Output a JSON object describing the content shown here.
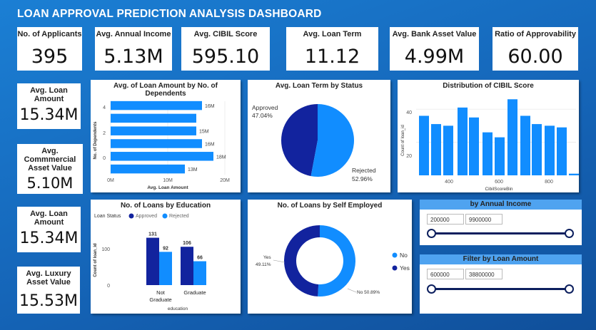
{
  "title": "LOAN APPROVAL PREDICTION ANALYSIS DASHBOARD",
  "kpis_top": [
    {
      "label": "No. of Applicants",
      "value": "395"
    },
    {
      "label": "Avg. Annual Income",
      "value": "5.13M"
    },
    {
      "label": "Avg. CIBIL Score",
      "value": "595.10"
    },
    {
      "label": "Avg. Loan Term",
      "value": "11.12"
    },
    {
      "label": "Avg. Bank Asset Value",
      "value": "4.99M"
    },
    {
      "label": "Ratio of Approvability",
      "value": "60.00"
    }
  ],
  "kpis_side": [
    {
      "label": "Avg. Loan Amount",
      "value": "15.34M"
    },
    {
      "label": "Avg. Commmercial Asset Value",
      "value": "5.10M"
    },
    {
      "label": "Avg. Loan Amount",
      "value": "15.34M"
    },
    {
      "label": "Avg. Luxury Asset Value",
      "value": "15.53M"
    }
  ],
  "charts": {
    "dependents": {
      "title": "Avg. of Loan Amount by No. of Dependents",
      "ylabel": "No. of Dependents",
      "xlabel": "Avg. Loan Amount",
      "xticks": [
        "0M",
        "10M",
        "20M"
      ]
    },
    "loan_term": {
      "title": "Avg. Loan Term by Status",
      "approved_label": "Approved",
      "approved_pct": "47.04%",
      "rejected_label": "Rejected",
      "rejected_pct": "52.96%"
    },
    "cibil": {
      "title": "Distribution of CIBIL Score",
      "ylabel": "Count of loan_id",
      "xlabel": "CibilScoreBin",
      "yticks": [
        "20",
        "40"
      ],
      "xticks": [
        "400",
        "600",
        "800"
      ]
    },
    "education": {
      "title": "No. of Loans by Education",
      "legend_title": "Loan Status",
      "legend_approved": "Approved",
      "legend_rejected": "Rejected",
      "ylabel": "Count of loan_id",
      "xlabel": "education",
      "yticks": [
        "0",
        "100"
      ],
      "cat1_line1": "Not",
      "cat1_line2": "Graduate",
      "cat2": "Graduate"
    },
    "self_employed": {
      "title": "No. of Loans by Self Employed",
      "yes_label": "Yes",
      "yes_pct": "49.11%",
      "no_label": "No 50.89%",
      "legend_no": "No",
      "legend_yes": "Yes"
    }
  },
  "sliders": {
    "income": {
      "title": "by Annual Income",
      "min": "200000",
      "max": "9900000"
    },
    "loan": {
      "title": "Filter by Loan Amount",
      "min": "600000",
      "max": "38800000"
    }
  },
  "colors": {
    "approved": "#12239e",
    "rejected": "#118dff",
    "bar": "#118dff"
  },
  "chart_data": [
    {
      "type": "bar",
      "title": "Avg. of Loan Amount by No. of Dependents",
      "orientation": "horizontal",
      "xlabel": "Avg. Loan Amount",
      "ylabel": "No. of Dependents",
      "categories": [
        "0",
        "1",
        "2",
        "3",
        "4",
        "5"
      ],
      "values": [
        13,
        18,
        16,
        15,
        15,
        16
      ],
      "data_labels": [
        "13M",
        "18M",
        "16M",
        "15M",
        "",
        "16M"
      ],
      "xlim": [
        0,
        20
      ],
      "tick_labels_y": [
        "0",
        "2",
        "4"
      ]
    },
    {
      "type": "pie",
      "title": "Avg. Loan Term by Status",
      "categories": [
        "Approved",
        "Rejected"
      ],
      "values": [
        47.04,
        52.96
      ]
    },
    {
      "type": "bar",
      "title": "Distribution of CIBIL Score",
      "xlabel": "CibilScoreBin",
      "ylabel": "Count of loan_id",
      "x": [
        320,
        370,
        410,
        460,
        500,
        545,
        590,
        640,
        680,
        725,
        765,
        810,
        850
      ],
      "values": [
        36,
        31,
        30,
        41,
        35,
        26,
        23,
        46,
        36,
        31,
        30,
        29,
        1
      ],
      "ylim": [
        0,
        50
      ]
    },
    {
      "type": "bar",
      "title": "No. of Loans by Education",
      "xlabel": "education",
      "ylabel": "Count of loan_id",
      "categories": [
        "Not Graduate",
        "Graduate"
      ],
      "series": [
        {
          "name": "Approved",
          "values": [
            131,
            106
          ]
        },
        {
          "name": "Rejected",
          "values": [
            92,
            66
          ]
        }
      ],
      "ylim": [
        0,
        140
      ]
    },
    {
      "type": "pie",
      "title": "No. of Loans by Self Employed",
      "categories": [
        "No",
        "Yes"
      ],
      "values": [
        50.89,
        49.11
      ],
      "donut": true
    }
  ]
}
